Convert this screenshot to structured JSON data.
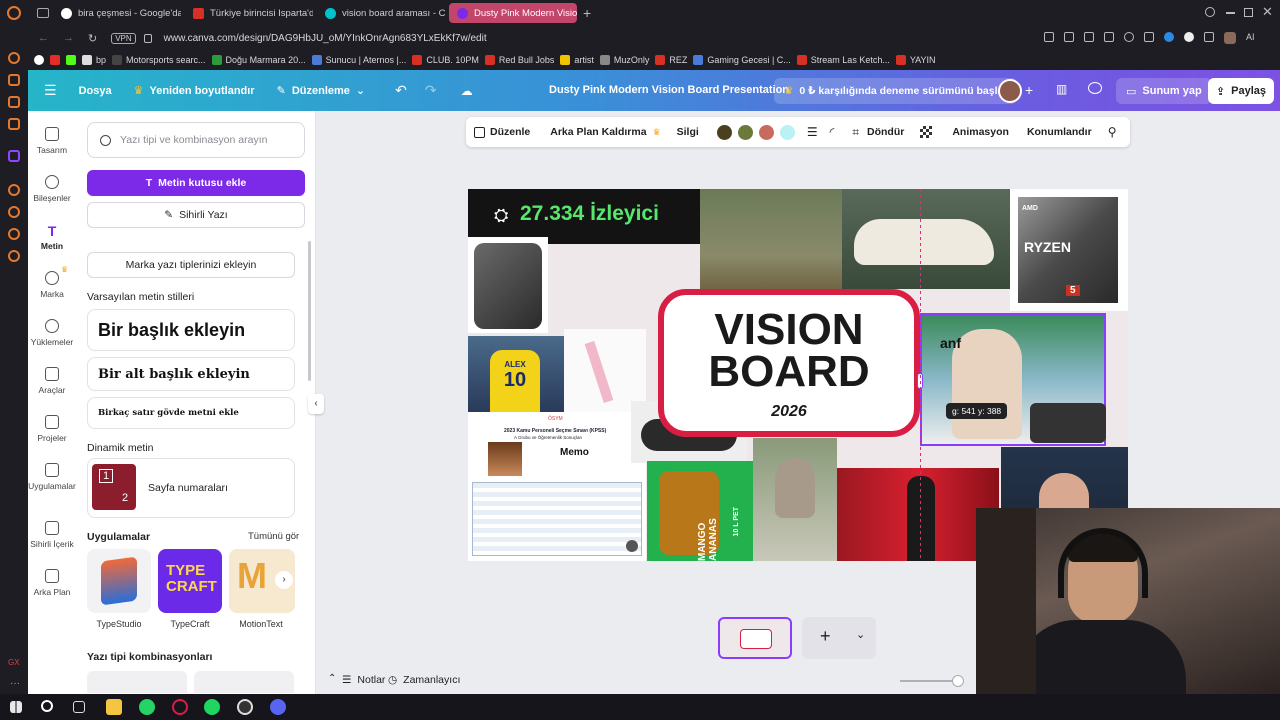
{
  "browser": {
    "tabs": [
      {
        "label": "bira çeşmesi - Google'da A",
        "color": "#4285f4"
      },
      {
        "label": "Türkiye birincisi Isparta'da",
        "color": "#d93025"
      },
      {
        "label": "vision board araması - Ca",
        "color": "#00c4cc"
      },
      {
        "label": "Dusty Pink Modern Vision",
        "color": "#7d2ae8"
      }
    ],
    "url": "www.canva.com/design/DAG9HbJU_oM/YInkOnrAgn683YLxEkKf7w/edit",
    "vpn_label": "VPN",
    "ai_label": "AI",
    "bookmarks": [
      "bp",
      "Motorsports searc...",
      "Doğu Marmara 20...",
      "Sunucu | Aternos |...",
      "CLUB. 10PM",
      "Red Bull Jobs",
      "artist",
      "MuzOnly",
      "REZ",
      "Gaming Gecesi | C...",
      "Stream Las Ketch...",
      "YAYIN"
    ]
  },
  "canva": {
    "header": {
      "file": "Dosya",
      "resize": "Yeniden boyutlandır",
      "edit": "Düzenleme",
      "title": "Dusty Pink Modern Vision Board Presentation",
      "trial": "0 ₺ karşılığında deneme sürümünü başlat",
      "present": "Sunum yap",
      "share": "Paylaş"
    },
    "rail": [
      "Tasarım",
      "Bileşenler",
      "Metin",
      "Marka",
      "Yüklemeler",
      "Araçlar",
      "Projeler",
      "Uygulamalar",
      "Sihirli İçerik",
      "Arka Plan"
    ],
    "panel": {
      "search_placeholder": "Yazı tipi ve kombinasyon arayın",
      "add_textbox": "Metin kutusu ekle",
      "magic_write": "Sihirli Yazı",
      "brand_fonts": "Marka yazı tiplerinizi ekleyin",
      "default_styles": "Varsayılan metin stilleri",
      "heading": "Bir başlık ekleyin",
      "subheading": "Bir alt başlık ekleyin",
      "body": "Birkaç satır gövde metni ekle",
      "dynamic": "Dinamik metin",
      "page_numbers": "Sayfa numaraları",
      "page_icon_1": "1",
      "page_icon_2": "2",
      "apps_title": "Uygulamalar",
      "see_all": "Tümünü gör",
      "apps": [
        "TypeStudio",
        "TypeCraft",
        "MotionText"
      ],
      "font_combos": "Yazı tipi kombinasyonları"
    },
    "toolbar": {
      "edit": "Düzenle",
      "remove_bg": "Arka Plan Kaldırma",
      "erase": "Silgi",
      "swatches": [
        "#4a3f1f",
        "#6b7a3a",
        "#c76b5e",
        "#b9f1f4"
      ],
      "flip": "Döndür",
      "animate": "Animasyon",
      "position": "Konumlandır"
    },
    "slide": {
      "viewers": "27.334 İzleyici",
      "title_line1": "VISION",
      "title_line2": "BOARD",
      "year": "2026",
      "size_tooltip": "g: 541 y: 388",
      "caption_anf": "anf",
      "memo": "Memo",
      "kpss_title": "2023 Kamu Personeli Seçme Sınavı (KPSS)",
      "kpss_sub": "A Grubu ve Öğretmenlik Sonuçları",
      "osym": "ÖSYM",
      "mango_text": "MANGO ANANAS",
      "mango_vol": "10 L PET",
      "jersey_name": "ALEX",
      "jersey_number": "10",
      "ryzen": "RYZEN",
      "ryzen_num": "5",
      "amd": "AMD"
    },
    "bottom": {
      "notes": "Notlar",
      "timer": "Zamanlayıcı",
      "add_page": "+"
    }
  }
}
